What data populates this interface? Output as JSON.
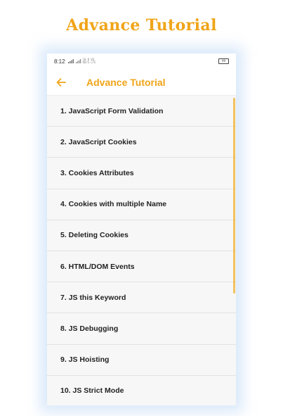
{
  "banner": {
    "title": "Advance Tutorial"
  },
  "status_bar": {
    "time": "8:12",
    "network_top": "10.0",
    "network_bottom": "KB/S",
    "network_type_top": "VO",
    "network_type_bottom": "LTE",
    "battery": "99"
  },
  "app_bar": {
    "title": "Advance Tutorial",
    "back_icon": "arrow-left-icon"
  },
  "colors": {
    "accent": "#f0a418",
    "list_background": "#f7f7f7",
    "divider": "#e2e2e2"
  },
  "list": {
    "items": [
      {
        "label": "1. JavaScript Form Validation"
      },
      {
        "label": "2. JavaScript Cookies"
      },
      {
        "label": "3. Cookies Attributes"
      },
      {
        "label": "4. Cookies with multiple Name"
      },
      {
        "label": "5. Deleting Cookies"
      },
      {
        "label": "6. HTML/DOM Events"
      },
      {
        "label": "7. JS this Keyword"
      },
      {
        "label": "8. JS Debugging"
      },
      {
        "label": "9. JS Hoisting"
      },
      {
        "label": "10. JS Strict Mode"
      }
    ]
  }
}
